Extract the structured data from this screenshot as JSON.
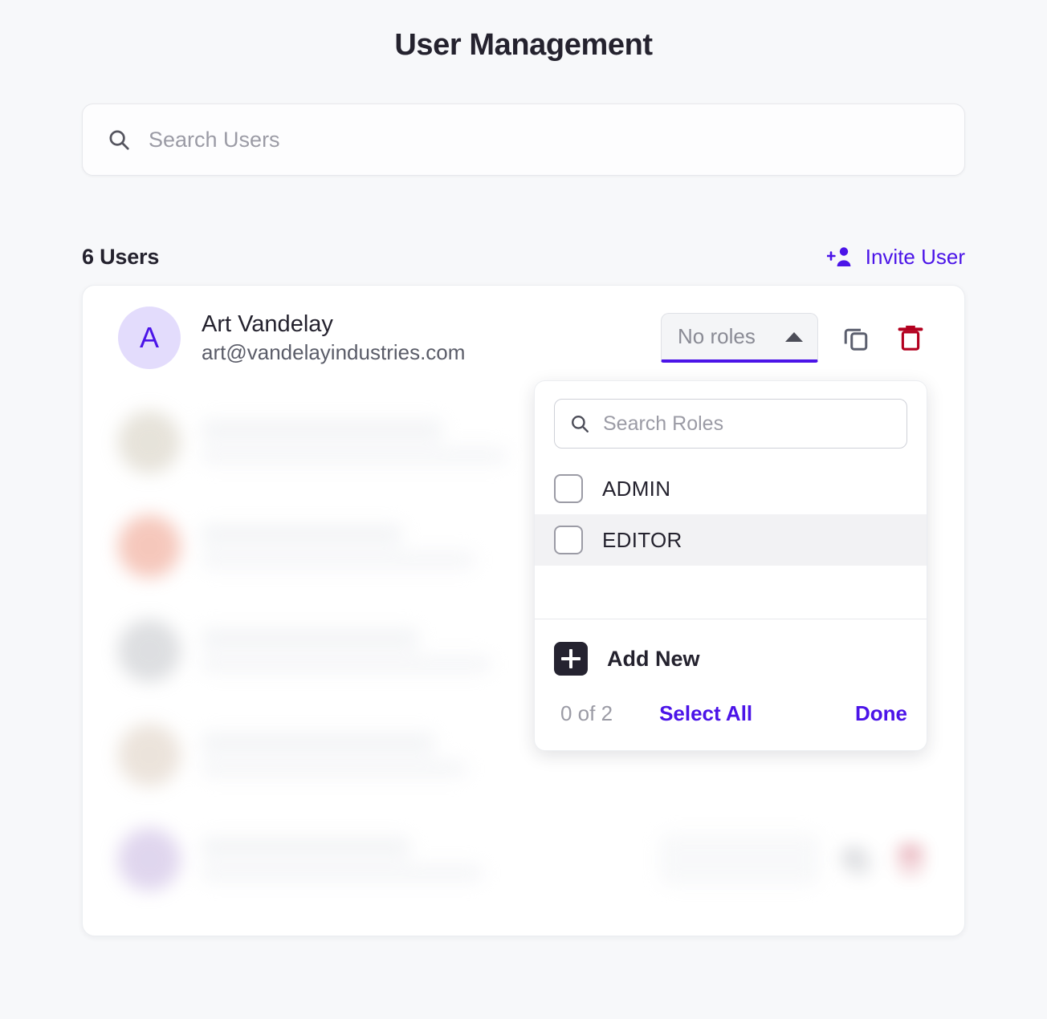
{
  "page": {
    "title": "User Management",
    "background_color": "#f7f8fa",
    "accent_color": "#4b14e8",
    "danger_color": "#b3001f"
  },
  "search": {
    "placeholder": "Search Users",
    "value": "",
    "icon": "search-icon"
  },
  "list_header": {
    "count_label": "6 Users",
    "invite_label": "Invite User",
    "invite_icon": "person-add-icon"
  },
  "users": [
    {
      "avatar_letter": "A",
      "avatar_bg": "#e3dcfc",
      "avatar_fg": "#4b14e8",
      "name": "Art Vandelay",
      "email": "art@vandelayindustries.com",
      "role_label": "No roles",
      "blurred": false
    },
    {
      "avatar_letter": "",
      "avatar_bg": "#d8d2c4",
      "avatar_fg": "#6b6455",
      "name": "",
      "email": "",
      "role_label": "",
      "blurred": true
    },
    {
      "avatar_letter": "",
      "avatar_bg": "#f0a693",
      "avatar_fg": "#a3523c",
      "name": "",
      "email": "",
      "role_label": "",
      "blurred": true
    },
    {
      "avatar_letter": "",
      "avatar_bg": "#c9cbcf",
      "avatar_fg": "#5b5f6e",
      "name": "",
      "email": "",
      "role_label": "",
      "blurred": true
    },
    {
      "avatar_letter": "",
      "avatar_bg": "#e0d3c6",
      "avatar_fg": "#8a7665",
      "name": "",
      "email": "",
      "role_label": "",
      "blurred": true
    },
    {
      "avatar_letter": "",
      "avatar_bg": "#cdbde4",
      "avatar_fg": "#6f4fa1",
      "name": "",
      "email": "",
      "role_label": "",
      "blurred": true
    }
  ],
  "row_actions": {
    "copy_icon": "copy-icon",
    "delete_icon": "trash-icon",
    "dropdown_caret_icon": "caret-up-icon"
  },
  "roles_dropdown": {
    "open": true,
    "search_placeholder": "Search Roles",
    "search_value": "",
    "options": [
      {
        "label": "ADMIN",
        "checked": false,
        "hovered": false
      },
      {
        "label": "EDITOR",
        "checked": false,
        "hovered": true
      }
    ],
    "add_new_label": "Add New",
    "add_new_icon": "plus-square-icon",
    "selection_count": "0 of 2",
    "select_all_label": "Select All",
    "done_label": "Done"
  }
}
